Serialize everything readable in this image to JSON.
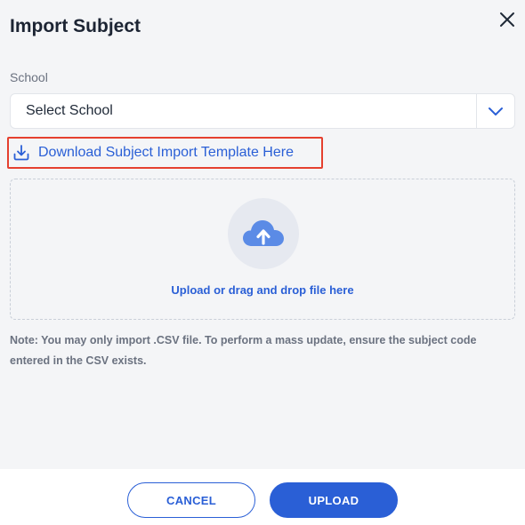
{
  "dialog": {
    "title": "Import Subject"
  },
  "school_field": {
    "label": "School",
    "selected_value": "Select School"
  },
  "download_link": {
    "label": "Download Subject Import Template Here"
  },
  "dropzone": {
    "text": "Upload or drag and drop file here"
  },
  "note": "Note: You may only import .CSV file. To perform a mass update, ensure the subject code entered in the CSV exists.",
  "footer": {
    "cancel_label": "CANCEL",
    "upload_label": "UPLOAD"
  },
  "colors": {
    "accent": "#2a5fd6",
    "highlight_border": "#e5402f",
    "cloud": "#5b8be6"
  },
  "icons": {
    "close": "close-icon",
    "dropdown": "chevron-down-icon",
    "download": "download-icon",
    "upload": "cloud-upload-icon"
  }
}
